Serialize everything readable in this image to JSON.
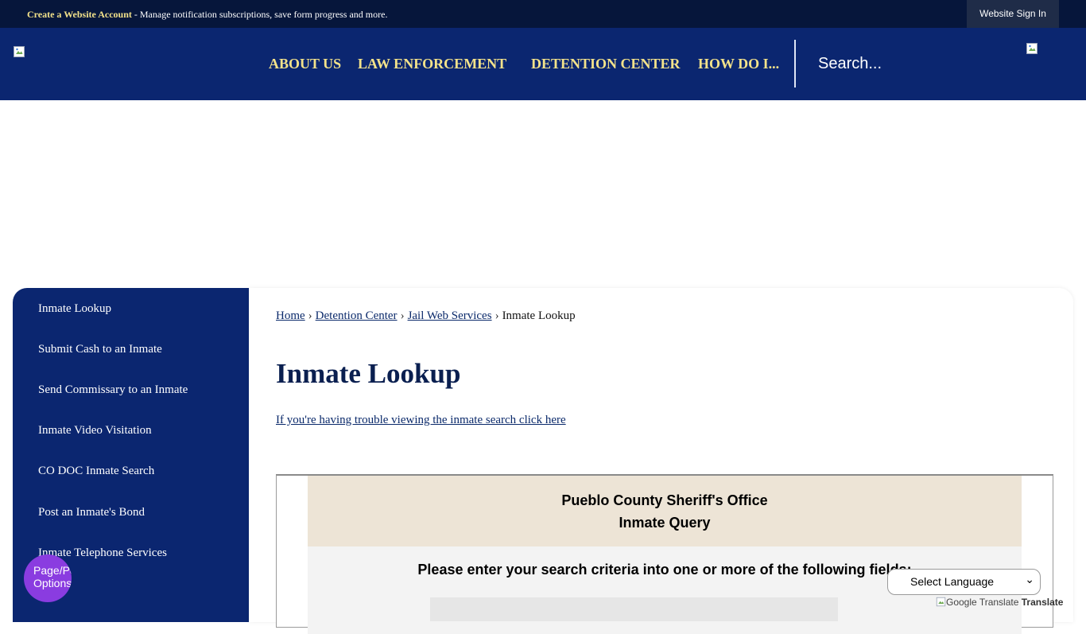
{
  "topbar": {
    "create_account": "Create a Website Account",
    "message": " - Manage notification subscriptions, save form progress and more.",
    "sign_in": "Website Sign In"
  },
  "header": {
    "nav": [
      "ABOUT US",
      "LAW ENFORCEMENT",
      "DETENTION CENTER",
      "HOW DO I..."
    ],
    "search_placeholder": "Search..."
  },
  "sidebar": {
    "items": [
      "Inmate Lookup",
      "Submit Cash to an Inmate",
      "Send Commissary to an Inmate",
      "Inmate Video Visitation",
      "CO DOC Inmate Search",
      "Post an Inmate's Bond",
      "Inmate Telephone Services"
    ]
  },
  "breadcrumb": {
    "items": [
      "Home",
      "Detention Center",
      "Jail Web Services"
    ],
    "current": "Inmate Lookup",
    "separator": "›"
  },
  "main": {
    "title": "Inmate Lookup",
    "trouble_link": "If you're having trouble viewing the inmate search click here",
    "query": {
      "org": "Pueblo County Sheriff's Office",
      "subtitle": "Inmate Query",
      "instructions": "Please enter your search criteria into one or more of the following fields:"
    }
  },
  "widgets": {
    "persona_alt": "Page/Persona Options",
    "language": "Select Language",
    "translate_img_alt": "Google Translate",
    "translate_label": "Translate"
  },
  "colors": {
    "header_bg": "#0b2670",
    "topbar_bg": "#06163b",
    "nav_text": "#f3e28a",
    "query_header_bg": "#ede4d6",
    "persona_bg": "#8a3ce0"
  }
}
